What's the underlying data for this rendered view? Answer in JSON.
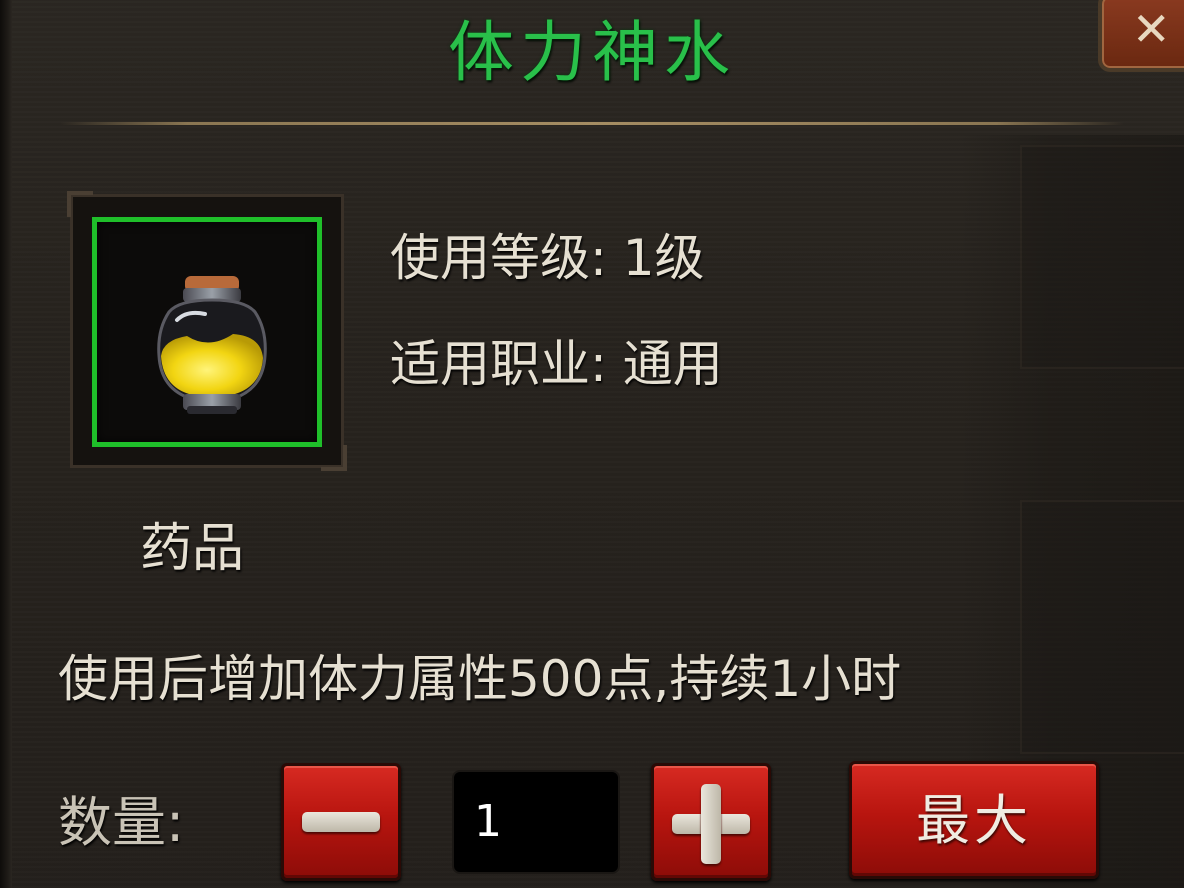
{
  "item": {
    "name": "体力神水",
    "name_color": "#29c04a",
    "rarity_frame_color": "#1fbf2a",
    "icon": "yellow-potion-icon",
    "use_level": "使用等级: 1级",
    "applicable_class": "适用职业: 通用",
    "category": "药品",
    "description": "使用后增加体力属性500点,持续1小时"
  },
  "quantity": {
    "label": "数量:",
    "value": "1",
    "max_label": "最大"
  },
  "buttons": {
    "close_icon": "close-icon",
    "button_color": "#c21a14"
  }
}
